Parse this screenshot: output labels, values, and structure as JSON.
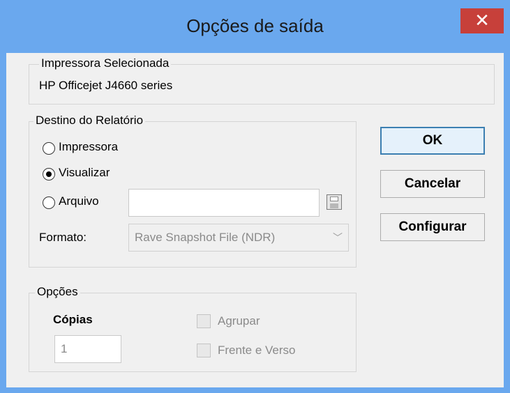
{
  "window": {
    "title": "Opções de saída",
    "close_label": "✕"
  },
  "printer_group": {
    "label": "Impressora Selecionada",
    "printer_name": "HP Officejet J4660 series"
  },
  "destination_group": {
    "label": "Destino do Relatório",
    "options": [
      {
        "label": "Impressora",
        "checked": false
      },
      {
        "label": "Visualizar",
        "checked": true
      },
      {
        "label": "Arquivo",
        "checked": false
      }
    ],
    "file_path": "",
    "format_label": "Formato:",
    "format_value": "Rave Snapshot File (NDR)",
    "save_icon": "floppy-disk-icon"
  },
  "options_group": {
    "label": "Opções",
    "copies_label": "Cópias",
    "copies_value": "1",
    "collate_label": "Agrupar",
    "duplex_label": "Frente e Verso"
  },
  "buttons": {
    "ok": "OK",
    "cancel": "Cancelar",
    "configure": "Configurar"
  }
}
